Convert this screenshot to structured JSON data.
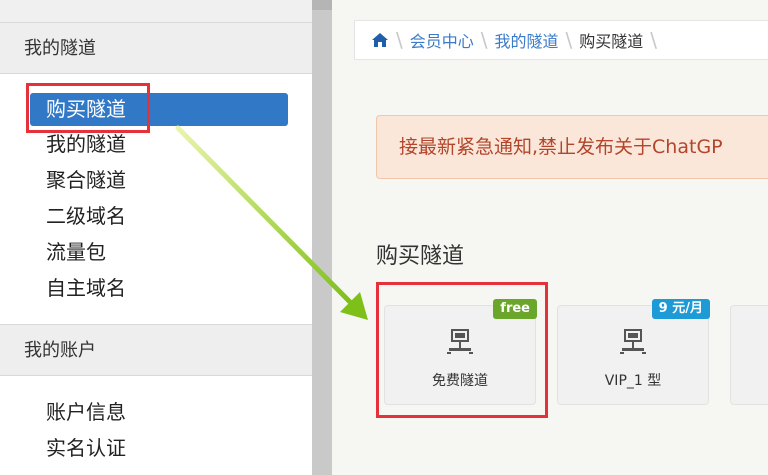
{
  "sidebar": {
    "section1_title": "我的隧道",
    "items1": [
      "购买隧道",
      "我的隧道",
      "聚合隧道",
      "二级域名",
      "流量包",
      "自主域名"
    ],
    "section2_title": "我的账户",
    "items2": [
      "账户信息",
      "实名认证"
    ]
  },
  "breadcrumb": {
    "items": [
      "会员中心",
      "我的隧道",
      "购买隧道"
    ]
  },
  "notice": {
    "text": "接最新紧急通知,禁止发布关于ChatGP"
  },
  "main": {
    "section_title": "购买隧道",
    "cards": [
      {
        "label": "免费隧道",
        "badge": "free"
      },
      {
        "label": "VIP_1 型",
        "badge": "9 元/月"
      }
    ]
  },
  "colors": {
    "accent": "#3178c6",
    "highlight": "#e5323a",
    "arrow": "#9acd32",
    "free_badge": "#6aa629",
    "vip_badge": "#1e9ad6"
  },
  "icons": [
    "home-icon",
    "network-icon"
  ]
}
